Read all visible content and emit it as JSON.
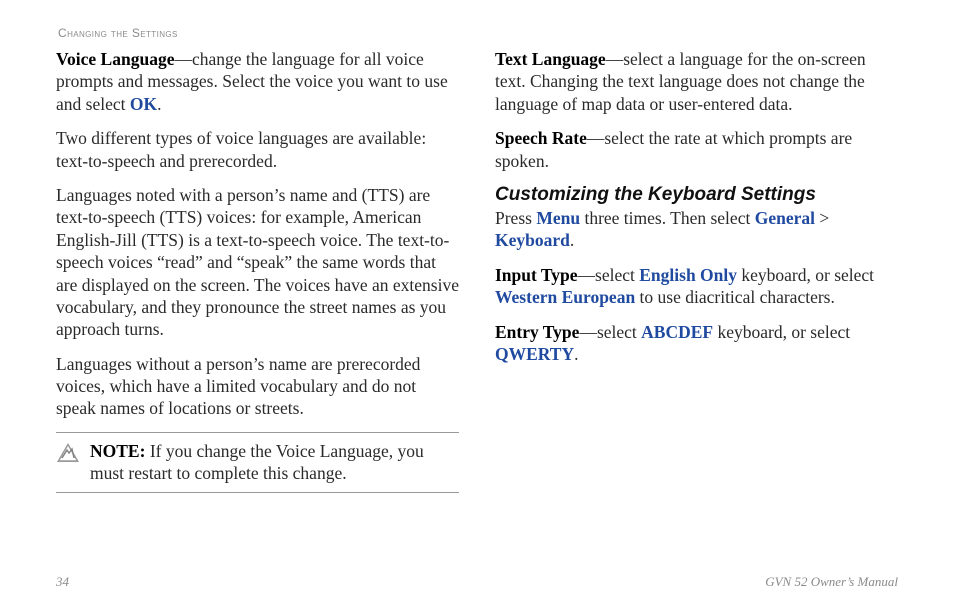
{
  "header": {
    "running_head": "Changing the Settings"
  },
  "left": {
    "p1": {
      "term": "Voice Language",
      "dash": "—",
      "body_a": "change the language for all voice prompts and messages. Select the voice you want to use and select ",
      "ok": "OK",
      "body_b": "."
    },
    "p2": "Two different types of voice languages are available: text-to-speech and prerecorded.",
    "p3": "Languages noted with a person’s name and (TTS) are text-to-speech (TTS) voices: for example, American English-Jill (TTS) is a text-to-speech voice. The text-to-speech voices “read” and “speak” the same words that are displayed on the screen. The voices have an extensive vocabulary, and they pronounce the street names as you approach turns.",
    "p4": "Languages without a person’s name are prerecorded voices, which have a limited vocabulary and do not speak names of locations or streets.",
    "note": {
      "label": "NOTE:",
      "body": " If you change the Voice Language, you must restart to complete this change."
    }
  },
  "right": {
    "p1": {
      "term": "Text Language",
      "dash": "—",
      "body": "select a language for the on-screen text. Changing the text language does not change the language of map data or user-entered data."
    },
    "p2": {
      "term": "Speech Rate",
      "dash": "—",
      "body": "select the rate at which prompts are spoken."
    },
    "h3": "Customizing the Keyboard Settings",
    "p3": {
      "a": "Press ",
      "menu": "Menu",
      "b": " three times. Then select ",
      "general": "General",
      "gt": " > ",
      "keyboard": "Keyboard",
      "c": "."
    },
    "p4": {
      "term": "Input Type",
      "dash": "—",
      "a": "select ",
      "english": "English Only",
      "b": " keyboard, or select ",
      "western": "Western European",
      "c": " to use diacritical characters."
    },
    "p5": {
      "term": "Entry Type",
      "dash": "—",
      "a": "select ",
      "abc": "ABCDEF",
      "b": " keyboard, or select ",
      "qwerty": "QWERTY",
      "c": "."
    }
  },
  "footer": {
    "page": "34",
    "doc": "GVN 52 Owner’s Manual"
  }
}
